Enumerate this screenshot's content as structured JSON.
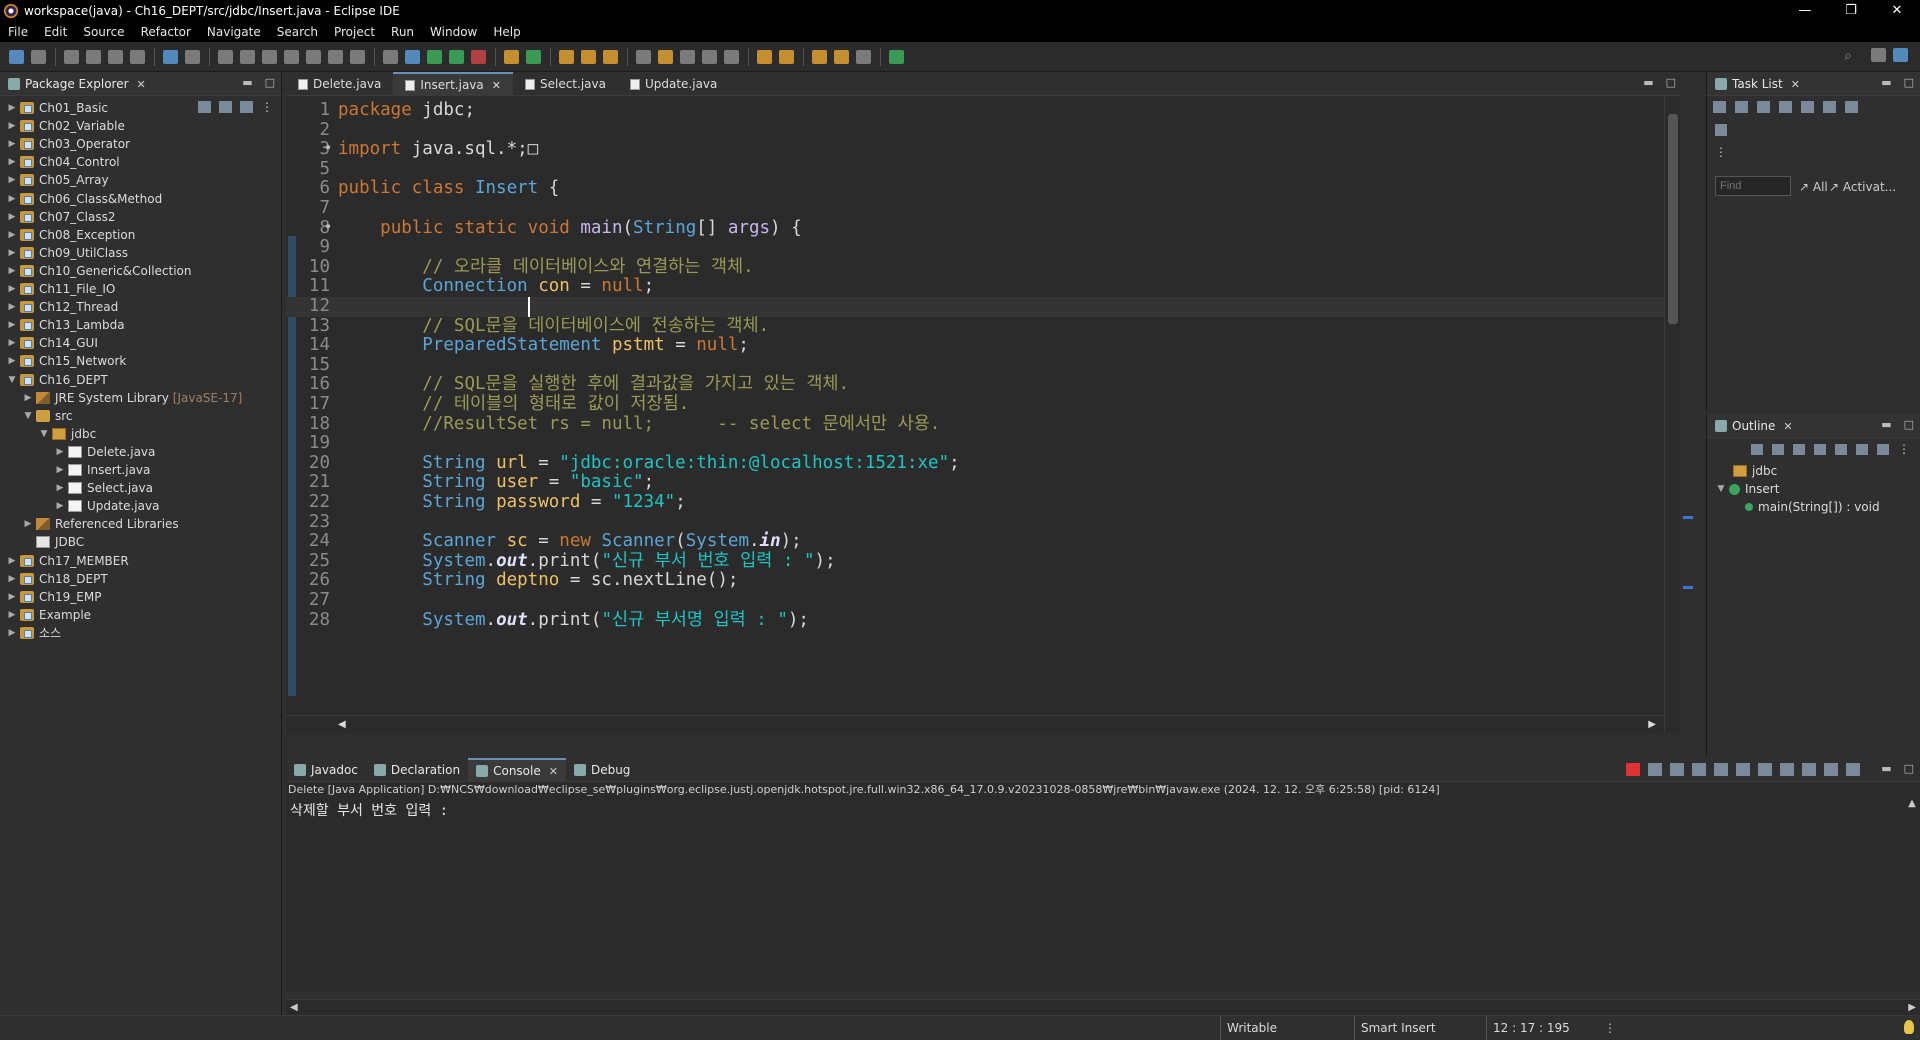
{
  "window": {
    "title": "workspace(java) - Ch16_DEPT/src/jdbc/Insert.java - Eclipse IDE",
    "buttons": [
      "—",
      "❐",
      "✕"
    ]
  },
  "menu": [
    "File",
    "Edit",
    "Source",
    "Refactor",
    "Navigate",
    "Search",
    "Project",
    "Run",
    "Window",
    "Help"
  ],
  "package_explorer": {
    "tab_label": "Package Explorer",
    "items": [
      {
        "label": "Ch01_Basic",
        "type": "project"
      },
      {
        "label": "Ch02_Variable",
        "type": "project"
      },
      {
        "label": "Ch03_Operator",
        "type": "project"
      },
      {
        "label": "Ch04_Control",
        "type": "project"
      },
      {
        "label": "Ch05_Array",
        "type": "project"
      },
      {
        "label": "Ch06_Class&Method",
        "type": "project"
      },
      {
        "label": "Ch07_Class2",
        "type": "project"
      },
      {
        "label": "Ch08_Exception",
        "type": "project"
      },
      {
        "label": "Ch09_UtilClass",
        "type": "project"
      },
      {
        "label": "Ch10_Generic&Collection",
        "type": "project"
      },
      {
        "label": "Ch11_File_IO",
        "type": "project"
      },
      {
        "label": "Ch12_Thread",
        "type": "project"
      },
      {
        "label": "Ch13_Lambda",
        "type": "project"
      },
      {
        "label": "Ch14_GUI",
        "type": "project"
      },
      {
        "label": "Ch15_Network",
        "type": "project"
      },
      {
        "label": "Ch16_DEPT",
        "type": "project",
        "expanded": true
      },
      {
        "label": "JRE System Library",
        "extra": "[JavaSE-17]",
        "type": "jre",
        "depth": 1
      },
      {
        "label": "src",
        "type": "src",
        "depth": 1,
        "expanded": true
      },
      {
        "label": "jdbc",
        "type": "pkg",
        "depth": 2,
        "expanded": true
      },
      {
        "label": "Delete.java",
        "type": "java",
        "depth": 3
      },
      {
        "label": "Insert.java",
        "type": "java",
        "depth": 3
      },
      {
        "label": "Select.java",
        "type": "java",
        "depth": 3
      },
      {
        "label": "Update.java",
        "type": "java",
        "depth": 3
      },
      {
        "label": "Referenced Libraries",
        "type": "lib",
        "depth": 1
      },
      {
        "label": "JDBC",
        "type": "file",
        "depth": 1,
        "leaf": true
      },
      {
        "label": "Ch17_MEMBER",
        "type": "project"
      },
      {
        "label": "Ch18_DEPT",
        "type": "project"
      },
      {
        "label": "Ch19_EMP",
        "type": "project"
      },
      {
        "label": "Example",
        "type": "project"
      },
      {
        "label": "소스",
        "type": "project"
      }
    ]
  },
  "editor": {
    "tabs": [
      {
        "label": "Delete.java",
        "active": false
      },
      {
        "label": "Insert.java",
        "active": true
      },
      {
        "label": "Select.java",
        "active": false
      },
      {
        "label": "Update.java",
        "active": false
      }
    ],
    "lines": [
      {
        "n": "1",
        "tokens": [
          [
            "kw",
            "package"
          ],
          [
            "pl",
            " jdbc;"
          ]
        ]
      },
      {
        "n": "2",
        "tokens": []
      },
      {
        "n": "3",
        "fold": "⊕",
        "tokens": [
          [
            "kw",
            "import"
          ],
          [
            "pl",
            " java.sql.*;"
          ],
          [
            "pl",
            "□"
          ]
        ]
      },
      {
        "n": "5",
        "tokens": []
      },
      {
        "n": "6",
        "tokens": [
          [
            "kw",
            "public class "
          ],
          [
            "ty",
            "Insert"
          ],
          [
            "pl",
            " {"
          ]
        ]
      },
      {
        "n": "7",
        "tokens": []
      },
      {
        "n": "8",
        "fold": "⊖",
        "tokens": [
          [
            "pl",
            "    "
          ],
          [
            "kw",
            "public static void "
          ],
          [
            "id",
            "main"
          ],
          [
            "pl",
            "("
          ],
          [
            "ty",
            "String"
          ],
          [
            "pl",
            "[] "
          ],
          [
            "id",
            "args"
          ],
          [
            "pl",
            ") {"
          ]
        ]
      },
      {
        "n": "9",
        "tokens": []
      },
      {
        "n": "10",
        "tokens": [
          [
            "pl",
            "        "
          ],
          [
            "cm",
            "// 오라클 데이터베이스와 연결하는 객체."
          ]
        ]
      },
      {
        "n": "11",
        "tokens": [
          [
            "pl",
            "        "
          ],
          [
            "ty",
            "Connection"
          ],
          [
            "pl",
            " "
          ],
          [
            "var",
            "con"
          ],
          [
            "pl",
            " = "
          ],
          [
            "kw",
            "null"
          ],
          [
            "pl",
            ";"
          ]
        ]
      },
      {
        "n": "12",
        "current": true,
        "tokens": []
      },
      {
        "n": "13",
        "tokens": [
          [
            "pl",
            "        "
          ],
          [
            "cm",
            "// SQL문을 데이터베이스에 전송하는 객체."
          ]
        ]
      },
      {
        "n": "14",
        "tokens": [
          [
            "pl",
            "        "
          ],
          [
            "ty",
            "PreparedStatement"
          ],
          [
            "pl",
            " "
          ],
          [
            "var",
            "pstmt"
          ],
          [
            "pl",
            " = "
          ],
          [
            "kw",
            "null"
          ],
          [
            "pl",
            ";"
          ]
        ]
      },
      {
        "n": "15",
        "tokens": []
      },
      {
        "n": "16",
        "tokens": [
          [
            "pl",
            "        "
          ],
          [
            "cm",
            "// SQL문을 실행한 후에 결과값을 가지고 있는 객체."
          ]
        ]
      },
      {
        "n": "17",
        "tokens": [
          [
            "pl",
            "        "
          ],
          [
            "cm",
            "// 테이블의 형태로 값이 저장됨."
          ]
        ]
      },
      {
        "n": "18",
        "tokens": [
          [
            "pl",
            "        "
          ],
          [
            "cm",
            "//ResultSet rs = null;      -- select 문에서만 사용."
          ]
        ]
      },
      {
        "n": "19",
        "tokens": []
      },
      {
        "n": "20",
        "tokens": [
          [
            "pl",
            "        "
          ],
          [
            "ty",
            "String"
          ],
          [
            "pl",
            " "
          ],
          [
            "var",
            "url"
          ],
          [
            "pl",
            " = "
          ],
          [
            "str",
            "\"jdbc:oracle:thin:@localhost:1521:xe\""
          ],
          [
            "pl",
            ";"
          ]
        ]
      },
      {
        "n": "21",
        "tokens": [
          [
            "pl",
            "        "
          ],
          [
            "ty",
            "String"
          ],
          [
            "pl",
            " "
          ],
          [
            "var",
            "user"
          ],
          [
            "pl",
            " = "
          ],
          [
            "str",
            "\"basic\""
          ],
          [
            "pl",
            ";"
          ]
        ]
      },
      {
        "n": "22",
        "tokens": [
          [
            "pl",
            "        "
          ],
          [
            "ty",
            "String"
          ],
          [
            "pl",
            " "
          ],
          [
            "var",
            "password"
          ],
          [
            "pl",
            " = "
          ],
          [
            "str",
            "\"1234\""
          ],
          [
            "pl",
            ";"
          ]
        ]
      },
      {
        "n": "23",
        "tokens": []
      },
      {
        "n": "24",
        "tokens": [
          [
            "pl",
            "        "
          ],
          [
            "ty",
            "Scanner"
          ],
          [
            "pl",
            " "
          ],
          [
            "var",
            "sc"
          ],
          [
            "pl",
            " = "
          ],
          [
            "kw",
            "new "
          ],
          [
            "ty",
            "Scanner"
          ],
          [
            "pl",
            "("
          ],
          [
            "ty",
            "System"
          ],
          [
            "pl",
            "."
          ],
          [
            "id",
            "in"
          ],
          [
            "pl",
            ");"
          ]
        ]
      },
      {
        "n": "25",
        "tokens": [
          [
            "pl",
            "        "
          ],
          [
            "ty",
            "System"
          ],
          [
            "pl",
            "."
          ],
          [
            "id",
            "out"
          ],
          [
            "pl",
            ".print("
          ],
          [
            "str",
            "\"신규 부서 번호 입력 : \""
          ],
          [
            "pl",
            ");"
          ]
        ]
      },
      {
        "n": "26",
        "tokens": [
          [
            "pl",
            "        "
          ],
          [
            "ty",
            "String"
          ],
          [
            "pl",
            " "
          ],
          [
            "var",
            "deptno"
          ],
          [
            "pl",
            " = sc.nextLine();"
          ]
        ]
      },
      {
        "n": "27",
        "tokens": []
      },
      {
        "n": "28",
        "tokens": [
          [
            "pl",
            "        "
          ],
          [
            "ty",
            "System"
          ],
          [
            "pl",
            "."
          ],
          [
            "id",
            "out"
          ],
          [
            "pl",
            ".print("
          ],
          [
            "str",
            "\"신규 부서명 입력 : \""
          ],
          [
            "pl",
            ");"
          ]
        ]
      }
    ]
  },
  "task_list": {
    "tab_label": "Task List",
    "find_placeholder": "Find",
    "filter_all": "All",
    "filter_activate": "Activat..."
  },
  "outline": {
    "tab_label": "Outline",
    "items": [
      {
        "label": "jdbc",
        "type": "pkg"
      },
      {
        "label": "Insert",
        "type": "class"
      },
      {
        "label": "main(String[]) : void",
        "type": "method"
      }
    ]
  },
  "console": {
    "tabs": [
      {
        "label": "Javadoc",
        "active": false
      },
      {
        "label": "Declaration",
        "active": false
      },
      {
        "label": "Console",
        "active": true
      },
      {
        "label": "Debug",
        "active": false
      }
    ],
    "info": "Delete [Java Application] D:₩NCS₩download₩eclipse_se₩plugins₩org.eclipse.justj.openjdk.hotspot.jre.full.win32.x86_64_17.0.9.v20231028-0858₩jre₩bin₩javaw.exe  (2024. 12. 12. 오후 6:25:58) [pid: 6124]",
    "output": "삭제할 부서 번호 입력 :"
  },
  "status": {
    "mode": "Writable",
    "insert": "Smart Insert",
    "position": "12 : 17 : 195"
  }
}
